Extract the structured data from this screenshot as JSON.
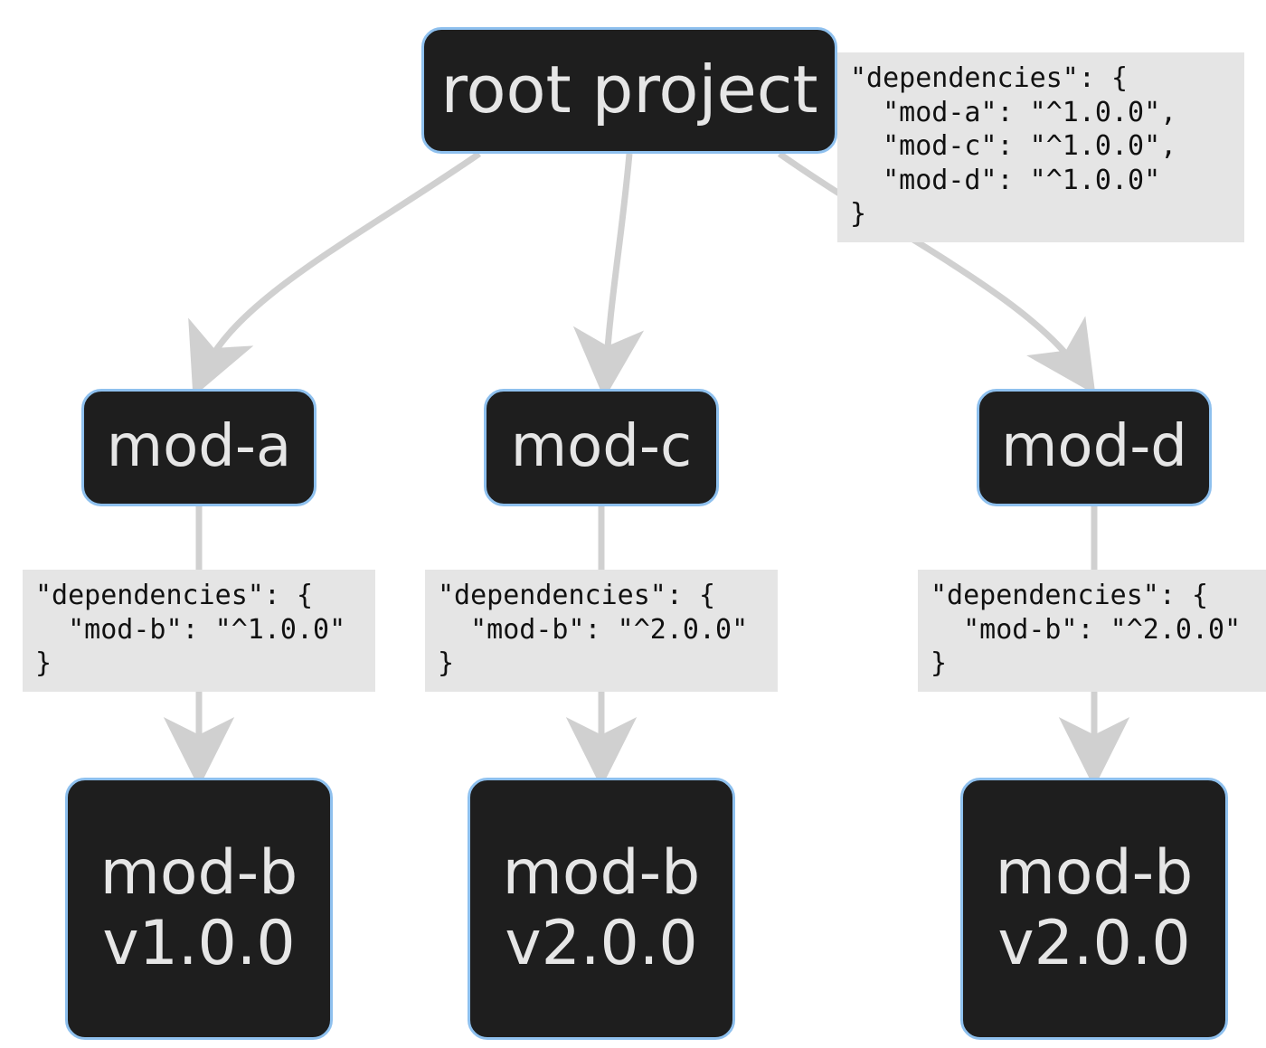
{
  "nodes": {
    "root": {
      "label": "root project"
    },
    "mod_a": {
      "label": "mod-a"
    },
    "mod_c": {
      "label": "mod-c"
    },
    "mod_d": {
      "label": "mod-d"
    },
    "mod_b_1": {
      "line1": "mod-b",
      "line2": "v1.0.0"
    },
    "mod_b_2": {
      "line1": "mod-b",
      "line2": "v2.0.0"
    },
    "mod_b_3": {
      "line1": "mod-b",
      "line2": "v2.0.0"
    }
  },
  "code": {
    "root": "\"dependencies\": {\n  \"mod-a\": \"^1.0.0\",\n  \"mod-c\": \"^1.0.0\",\n  \"mod-d\": \"^1.0.0\"\n}",
    "a": "\"dependencies\": {\n  \"mod-b\": \"^1.0.0\"\n}",
    "c": "\"dependencies\": {\n  \"mod-b\": \"^2.0.0\"\n}",
    "d": "\"dependencies\": {\n  \"mod-b\": \"^2.0.0\"\n}"
  },
  "graph": {
    "edges": [
      {
        "from": "root",
        "to": "mod_a"
      },
      {
        "from": "root",
        "to": "mod_c"
      },
      {
        "from": "root",
        "to": "mod_d"
      },
      {
        "from": "mod_a",
        "to": "mod_b_1"
      },
      {
        "from": "mod_c",
        "to": "mod_b_2"
      },
      {
        "from": "mod_d",
        "to": "mod_b_3"
      }
    ]
  }
}
